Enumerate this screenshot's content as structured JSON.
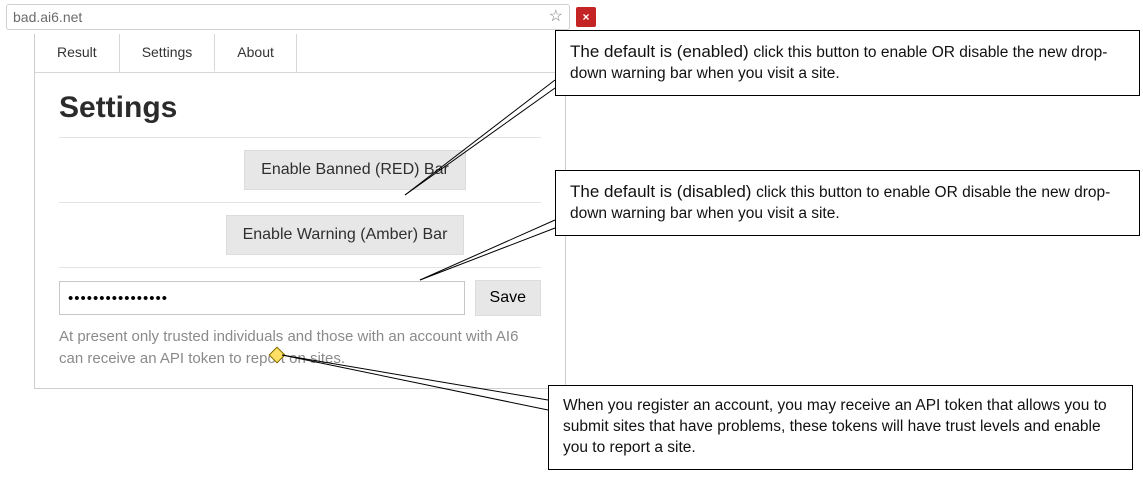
{
  "browser": {
    "url_display": "bad.ai6.net",
    "star_glyph": "☆",
    "ext_glyph": "×"
  },
  "tabs": {
    "result": "Result",
    "settings": "Settings",
    "about": "About",
    "active": "settings"
  },
  "settings": {
    "heading": "Settings",
    "enable_banned_label": "Enable Banned (RED) Bar",
    "enable_warning_label": "Enable Warning (Amber) Bar",
    "token_value": "••••••••••••••••",
    "save_label": "Save",
    "note_text": "At present only trusted individuals and those with an account with AI6 can receive an API token to report on sites."
  },
  "callouts": {
    "c1_lead": "The default is (enabled) ",
    "c1_rest": "click this button to enable OR disable the new drop-down warning bar when you visit a site.",
    "c2_lead": "The default is (disabled) ",
    "c2_rest": "click this button to enable OR disable the new drop-down warning bar when you visit a site.",
    "c3": "When you register an account, you may receive an API token that allows you to submit sites that have problems, these tokens will have trust levels and enable you to report a site."
  }
}
